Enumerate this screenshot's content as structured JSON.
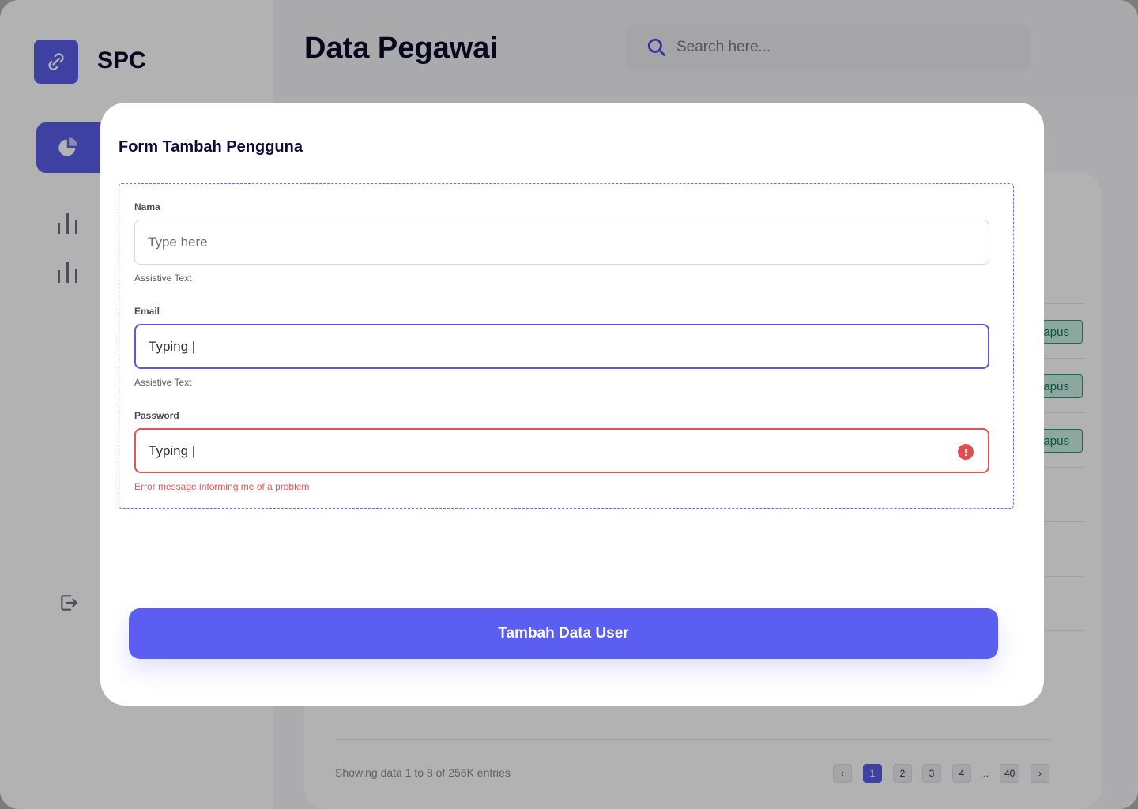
{
  "app": {
    "brand": "SPC",
    "page_title": "Data Pegawai"
  },
  "search": {
    "placeholder": "Search here..."
  },
  "table": {
    "row_action_label": "Hapus",
    "row_action_visible": "apus",
    "footer_text": "Showing data 1 to 8 of  256K entries",
    "pagination": {
      "prev": "‹",
      "next": "›",
      "pages": [
        "1",
        "2",
        "3",
        "4"
      ],
      "ellipsis": "...",
      "last": "40",
      "active": "1"
    }
  },
  "modal": {
    "title": "Form Tambah Pengguna",
    "fields": [
      {
        "label": "Nama",
        "placeholder": "Type here",
        "value": "",
        "helper": "Assistive Text",
        "state": "default"
      },
      {
        "label": "Email",
        "value": "Typing |",
        "helper": "Assistive Text",
        "state": "focused"
      },
      {
        "label": "Password",
        "value": "Typing |",
        "helper": "Error message informing me of a problem",
        "state": "error"
      }
    ],
    "error_icon": "!",
    "submit_label": "Tambah Data User"
  },
  "colors": {
    "accent": "#5b5ef0",
    "focus": "#6b4fe0",
    "error": "#e05454",
    "success": "#1b9c7a"
  },
  "icons": [
    "link-icon",
    "pie-chart-icon",
    "bar-chart-icon",
    "logout-icon",
    "search-icon",
    "error-icon"
  ]
}
